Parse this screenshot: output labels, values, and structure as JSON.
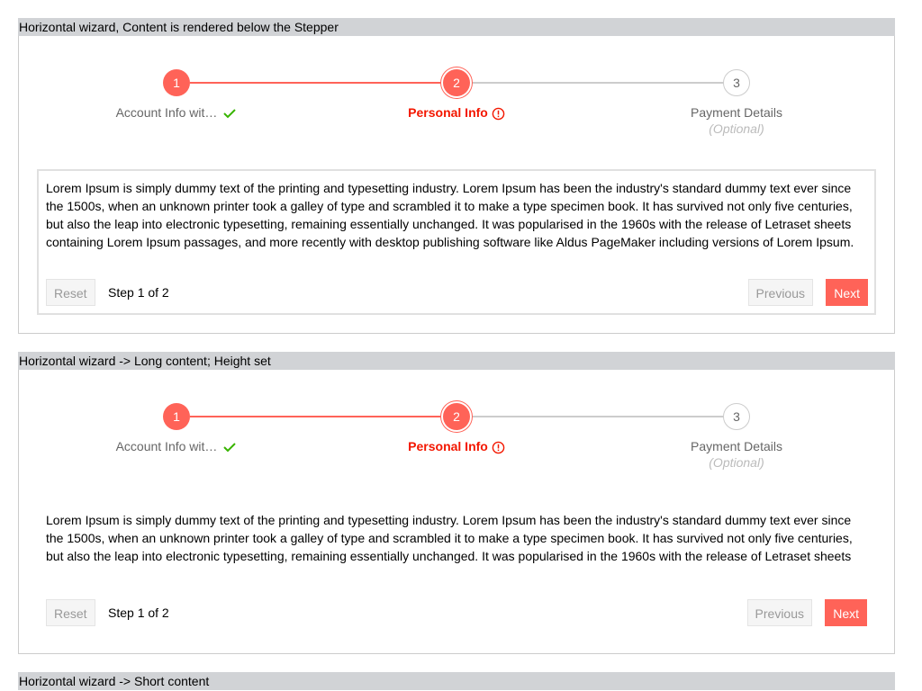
{
  "sections": [
    {
      "title": "Horizontal wizard, Content is rendered below the Stepper"
    },
    {
      "title": "Horizontal wizard -> Long content; Height set"
    },
    {
      "title": "Horizontal wizard -> Short content"
    }
  ],
  "steps": [
    {
      "number": "1",
      "label": "Account Info wit…",
      "state": "done",
      "icon": "check-icon"
    },
    {
      "number": "2",
      "label": "Personal Info",
      "state": "error",
      "icon": "exclamation-circle-icon"
    },
    {
      "number": "3",
      "label": "Payment Details",
      "optional": "(Optional)",
      "state": "pending"
    }
  ],
  "content": "Lorem Ipsum is simply dummy text of the printing and typesetting industry. Lorem Ipsum has been the industry's standard dummy text ever since the 1500s, when an unknown printer took a galley of type and scrambled it to make a type specimen book. It has survived not only five centuries, but also the leap into electronic typesetting, remaining essentially unchanged. It was popularised in the 1960s with the release of Letraset sheets containing Lorem Ipsum passages, and more recently with desktop publishing software like Aldus PageMaker including versions of Lorem Ipsum.",
  "buttons": {
    "reset": "Reset",
    "previous": "Previous",
    "next": "Next"
  },
  "step_info": "Step 1 of 2",
  "colors": {
    "accent": "#ff6358",
    "error": "#f31700",
    "success": "#37b400"
  }
}
